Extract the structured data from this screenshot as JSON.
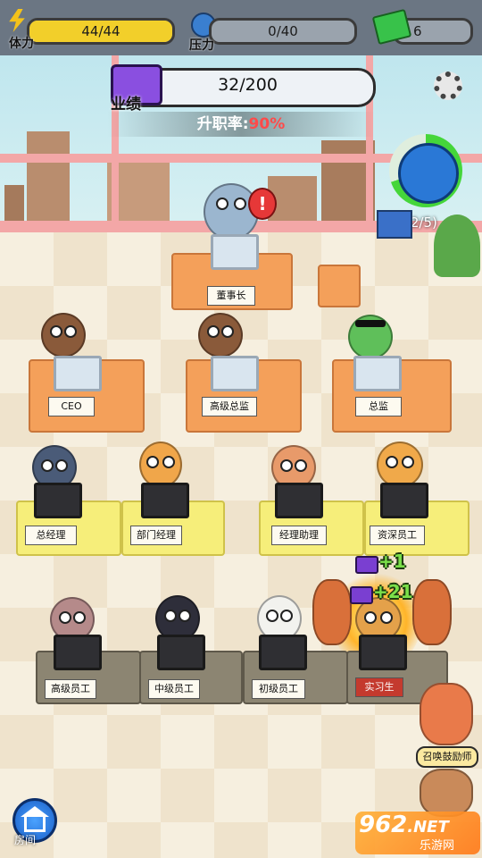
{
  "top_bar": {
    "stamina": {
      "label": "体力",
      "value": "44/44",
      "fill": 1.0,
      "color": "#f2cf2a"
    },
    "stress": {
      "label": "压力",
      "value": "0/40",
      "fill": 0.0
    },
    "cash": {
      "value": "6",
      "color": "#38c24a"
    }
  },
  "performance": {
    "label": "业绩",
    "value": "32/200",
    "promotion_label": "升职率:",
    "promotion_value": "90%",
    "promotion_color": "#ff4a4a"
  },
  "settings_icon": "gear-icon",
  "desks": {
    "chairman": "董事长",
    "row1": [
      "CEO",
      "高级总监",
      "总监"
    ],
    "row2": [
      "总经理",
      "部门经理",
      "经理助理",
      "资深员工"
    ],
    "row3": [
      "高级员工",
      "中级员工",
      "初级员工",
      "实习生"
    ]
  },
  "gains": [
    {
      "text": "+1"
    },
    {
      "text": "+21"
    }
  ],
  "blob_widget": {
    "count": "(2/5)"
  },
  "cheerleader": {
    "label": "召唤鼓励师"
  },
  "home": {
    "label": "房间"
  },
  "watermark": {
    "number": "962",
    "suffix": ".NET",
    "site": "乐游网"
  }
}
